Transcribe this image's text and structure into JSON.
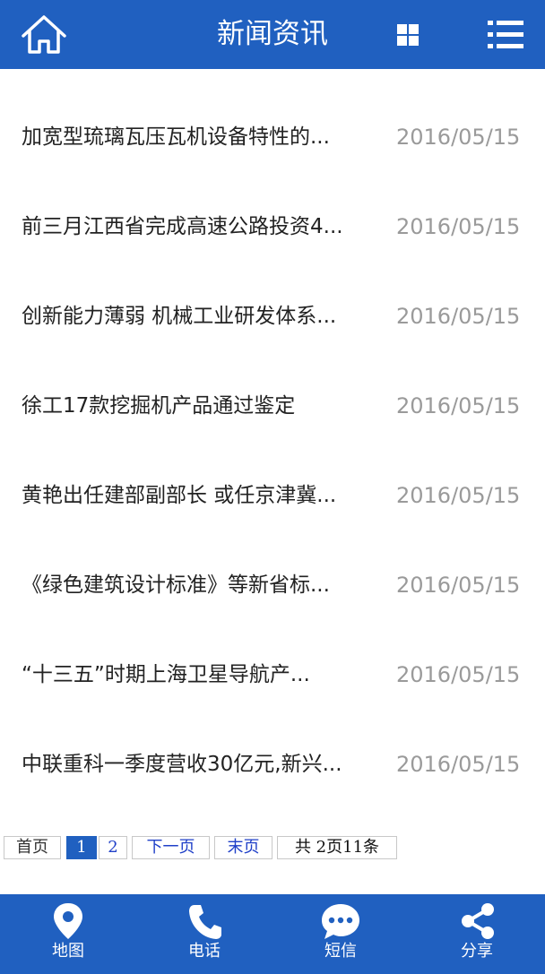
{
  "header": {
    "title": "新闻资讯",
    "home_icon": "home-icon",
    "grid_icon": "grid-icon",
    "menu_icon": "list-menu-icon"
  },
  "news": [
    {
      "title": "加宽型琉璃瓦压瓦机设备特性的...",
      "date": "2016/05/15"
    },
    {
      "title": "前三月江西省完成高速公路投资4...",
      "date": "2016/05/15"
    },
    {
      "title": "创新能力薄弱 机械工业研发体系...",
      "date": "2016/05/15"
    },
    {
      "title": "徐工17款挖掘机产品通过鉴定",
      "date": "2016/05/15"
    },
    {
      "title": "黄艳出任建部副部长 或任京津冀...",
      "date": "2016/05/15"
    },
    {
      "title": "《绿色建筑设计标准》等新省标...",
      "date": "2016/05/15"
    },
    {
      "title": "“十三五”时期上海卫星导航产...",
      "date": "2016/05/15"
    },
    {
      "title": "中联重科一季度营收30亿元,新兴...",
      "date": "2016/05/15"
    }
  ],
  "pagination": {
    "first": "首页",
    "page1": "1",
    "page2": "2",
    "next": "下一页",
    "last": "末页",
    "total": "共  2页11条"
  },
  "bottom_nav": [
    {
      "label": "地图",
      "icon": "map-pin-icon"
    },
    {
      "label": "电话",
      "icon": "phone-icon"
    },
    {
      "label": "短信",
      "icon": "message-icon"
    },
    {
      "label": "分享",
      "icon": "share-icon"
    }
  ],
  "colors": {
    "brand": "#2060c0",
    "date_text": "#9a9a9a",
    "title_text": "#222222"
  }
}
